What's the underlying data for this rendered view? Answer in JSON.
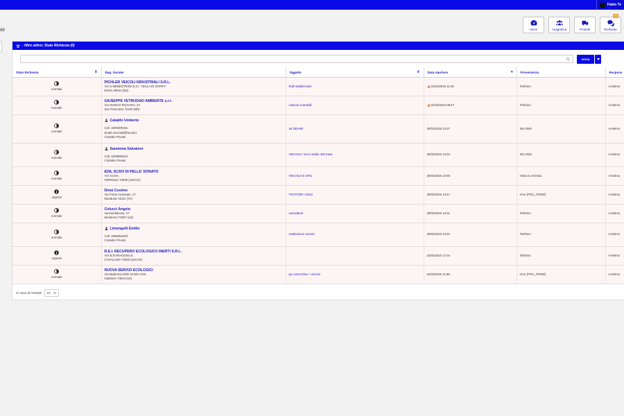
{
  "topbar": {
    "user_name": "Fabio Te"
  },
  "left_mark": "88",
  "nav": [
    {
      "label": "Home",
      "icon": "dashboard-icon",
      "badge": ""
    },
    {
      "label": "Anagrafica",
      "icon": "users-icon",
      "badge": ""
    },
    {
      "label": "Prodotti",
      "icon": "truck-icon",
      "badge": ""
    },
    {
      "label": "Richieste",
      "icon": "comments-icon",
      "badge": "98"
    }
  ],
  "panel": {
    "title": "- filtro attivo: Stato Richiesta (0)"
  },
  "search": {
    "placeholder": "",
    "button_label": "cerca"
  },
  "table": {
    "headers": [
      {
        "label": "Stato Richiesta",
        "sort": "⇕"
      },
      {
        "label": "Rag. Sociale",
        "sort": ""
      },
      {
        "label": "Oggetto",
        "sort": "⇕"
      },
      {
        "label": "Data Apertura",
        "sort": "▾"
      },
      {
        "label": "Provenienza",
        "sort": ""
      },
      {
        "label": "Respons",
        "sort": ""
      }
    ],
    "rows": [
      {
        "stato": "normale",
        "icon": "half",
        "person": false,
        "name": "PICHLER VEICOLI INDUSTRIALI S.R.L.",
        "lines": [
          "VIA S.MENESTRINA,8 Z.I. \"ISOLA DI SOPRA\"",
          "EGNA 39044 (BZ)"
        ],
        "oggetto": "Rulli stabilizzatori",
        "warn": true,
        "data": "01/04/2016 11:25",
        "provenienza": "Telefono",
        "resp": "Anselmo"
      },
      {
        "stato": "normale",
        "icon": "half",
        "person": false,
        "name": "GIUSEPPE VETRUGNO AMBIENTE s.r.l.",
        "lines": [
          "VIA MARCO PACUVIO, 23",
          "San Pancrazio 72100 (BR)"
        ],
        "oggetto": "cassoni scarrabili",
        "warn": true,
        "data": "01/04/2016 08:47",
        "provenienza": "Telefono",
        "resp": "Anselmo"
      },
      {
        "stato": "normale",
        "icon": "half",
        "person": true,
        "name": "Cataldo Umberto",
        "lines": [
          "Cell. 3290309191",
          "Email eicomail@hecali.it",
          "Contatto Privato"
        ],
        "oggetto": "ad 260×89",
        "warn": false,
        "data": "30/03/2016 14:07",
        "provenienza": "Sito Web",
        "resp": "Anselmo"
      },
      {
        "stato": "normale",
        "icon": "half",
        "person": true,
        "name": "Saramma Salvatore",
        "lines": [
          "Cell. 3209699152",
          "Contatto Privato"
        ],
        "oggetto": "VEICOLO: iveco stralis 430 trasa",
        "warn": false,
        "data": "30/03/2016 14:04",
        "provenienza": "Sito Web",
        "resp": "Anselmo"
      },
      {
        "stato": "normale",
        "icon": "half",
        "person": false,
        "name": "EDIL SCAVI DI PELLE' DONATO",
        "lines": [
          "VIA ACAIA,",
          "VERNOLE 73029 (LECCE)"
        ],
        "oggetto": "VEICOLO E GRU",
        "warn": false,
        "data": "30/03/2016 13:58",
        "provenienza": "Visita in Azienda",
        "resp": "Anselmo"
      },
      {
        "stato": "urgente",
        "icon": "info",
        "person": false,
        "name": "Dinoi Cosimo",
        "lines": [
          "Via Ponte Incassato, 17",
          "Manduria 74024 (TA)"
        ],
        "oggetto": "TRATTORI >2010",
        "warn": false,
        "data": "30/03/2016 13:47",
        "provenienza": "error {POC_FROM}",
        "resp": "Anselmo"
      },
      {
        "stato": "normale",
        "icon": "half",
        "person": false,
        "name": "Colucci Angelo",
        "lines": [
          "via Monfalcone, 17",
          "Monteroni 73047 (LE)"
        ],
        "oggetto": "escavatore",
        "warn": false,
        "data": "29/03/2016 13:31",
        "provenienza": "Telefono",
        "resp": "Anselmo"
      },
      {
        "stato": "normale",
        "icon": "half",
        "person": true,
        "name": "Limongelli Emilio",
        "lines": [
          "Cell. 3486051603",
          "Contatto Privato"
        ],
        "oggetto": "sostituzione veicolo",
        "warn": false,
        "data": "29/03/2016 13:22",
        "provenienza": "Telefono",
        "resp": "Anselmo"
      },
      {
        "stato": "urgente",
        "icon": "info",
        "person": false,
        "name": "R.E.I. RECUPERO ECOLOGICO INERTI S.R.L.",
        "lines": [
          "VIA B.D'ARAGONA,6",
          "CAVALLINO 73020 (LECCE)"
        ],
        "oggetto": "",
        "warn": false,
        "data": "24/03/2016 17:04",
        "provenienza": "Telefono",
        "resp": "Anselmo"
      },
      {
        "stato": "normale",
        "icon": "half",
        "person": false,
        "name": "NUOVA SERVIZI ECOLOGICI",
        "lines": [
          "Via Madonna Delle Grazie SNC",
          "Galatone 73044 (LE)"
        ],
        "oggetto": "gru carrozzina + veicolo",
        "warn": false,
        "data": "24/03/2016 11:58",
        "provenienza": "error {POC_FROM}",
        "resp": "Anselmo"
      }
    ]
  },
  "footer": {
    "label": "Ci sono di mostrari",
    "page_size": "10"
  }
}
